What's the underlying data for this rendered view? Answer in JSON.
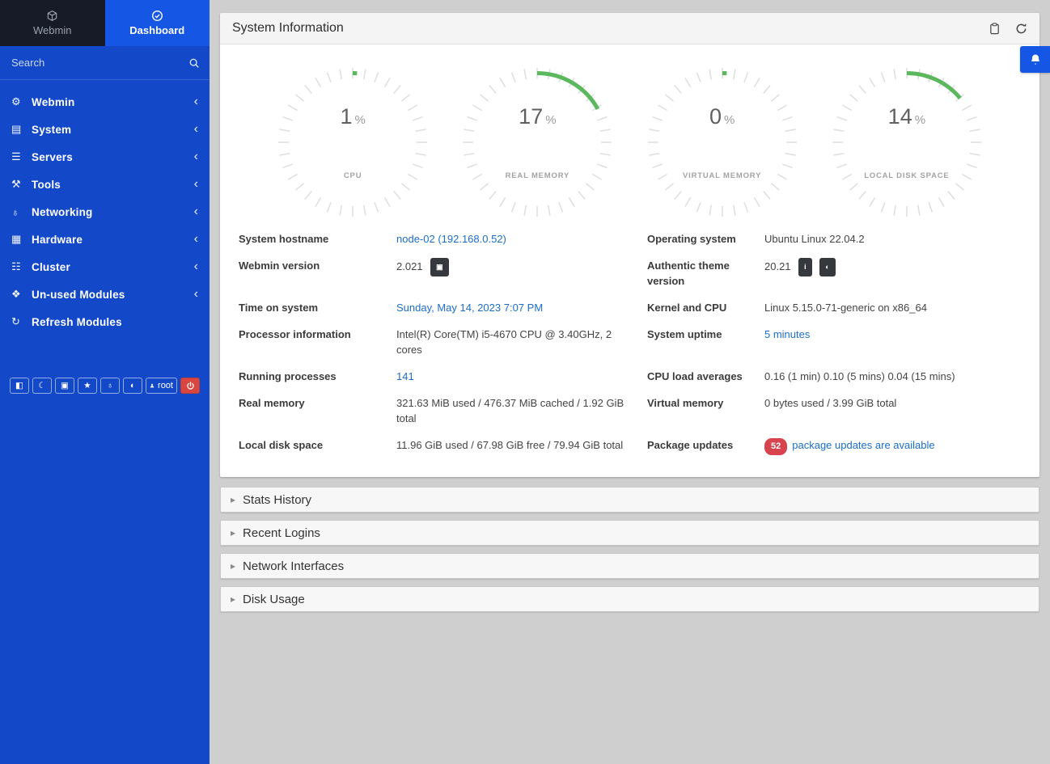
{
  "icons": {
    "menu_chevron": "‹",
    "panel_chevron": "▸",
    "package_glyph": "▣",
    "info_glyph": "i",
    "palette_glyph": "◐"
  },
  "colors": {
    "sidebar_blue": "#1349c9",
    "active_tab_blue": "#1556e4",
    "gauge_arc_green": "#5cb85c",
    "link_blue": "#1b6ec8",
    "badge_red": "#d9434f"
  },
  "sidebar": {
    "tabs": {
      "webmin": {
        "label": "Webmin"
      },
      "dashboard": {
        "label": "Dashboard"
      }
    },
    "search": {
      "placeholder": "Search"
    },
    "items": [
      {
        "label": "Webmin",
        "icon": "⚙"
      },
      {
        "label": "System",
        "icon": "▤"
      },
      {
        "label": "Servers",
        "icon": "☰"
      },
      {
        "label": "Tools",
        "icon": "⚒"
      },
      {
        "label": "Networking",
        "icon": "♁"
      },
      {
        "label": "Hardware",
        "icon": "▦"
      },
      {
        "label": "Cluster",
        "icon": "☷"
      },
      {
        "label": "Un-used Modules",
        "icon": "❖"
      }
    ],
    "refresh_modules": {
      "label": "Refresh Modules",
      "icon": "↻"
    },
    "footer": {
      "buttons": [
        {
          "glyph": "◧"
        },
        {
          "glyph": "☾"
        },
        {
          "glyph": "▣"
        },
        {
          "glyph": "★"
        },
        {
          "glyph": "♁"
        },
        {
          "glyph": "◐"
        }
      ],
      "user_label": "root"
    }
  },
  "main": {
    "title": "System Information",
    "gauges": [
      {
        "value": 1,
        "unit": "%",
        "label": "CPU"
      },
      {
        "value": 17,
        "unit": "%",
        "label": "REAL MEMORY"
      },
      {
        "value": 0,
        "unit": "%",
        "label": "VIRTUAL MEMORY"
      },
      {
        "value": 14,
        "unit": "%",
        "label": "LOCAL DISK SPACE"
      }
    ],
    "info": {
      "hostname_label": "System hostname",
      "hostname_value": "node-02 (192.168.0.52)",
      "os_label": "Operating system",
      "os_value": "Ubuntu Linux 22.04.2",
      "webmin_version_label": "Webmin version",
      "webmin_version_value": "2.021",
      "theme_version_label": "Authentic theme version",
      "theme_version_value": "20.21",
      "time_label": "Time on system",
      "time_value": "Sunday, May 14, 2023 7:07 PM",
      "kernel_label": "Kernel and CPU",
      "kernel_value": "Linux 5.15.0-71-generic on x86_64",
      "processor_label": "Processor information",
      "processor_value": "Intel(R) Core(TM) i5-4670 CPU @ 3.40GHz, 2 cores",
      "uptime_label": "System uptime",
      "uptime_value": "5 minutes",
      "processes_label": "Running processes",
      "processes_value": "141",
      "load_label": "CPU load averages",
      "load_value": "0.16 (1 min) 0.10 (5 mins) 0.04 (15 mins)",
      "real_memory_label": "Real memory",
      "real_memory_value": "321.63 MiB used / 476.37 MiB cached / 1.92 GiB total",
      "virtual_memory_label": "Virtual memory",
      "virtual_memory_value": "0 bytes used / 3.99 GiB total",
      "disk_label": "Local disk space",
      "disk_value": "11.96 GiB used / 67.98 GiB free / 79.94 GiB total",
      "packages_label": "Package updates",
      "packages_badge": "52",
      "packages_link": "package updates are available"
    },
    "panels": [
      {
        "label": "Stats History"
      },
      {
        "label": "Recent Logins"
      },
      {
        "label": "Network Interfaces"
      },
      {
        "label": "Disk Usage"
      }
    ]
  }
}
